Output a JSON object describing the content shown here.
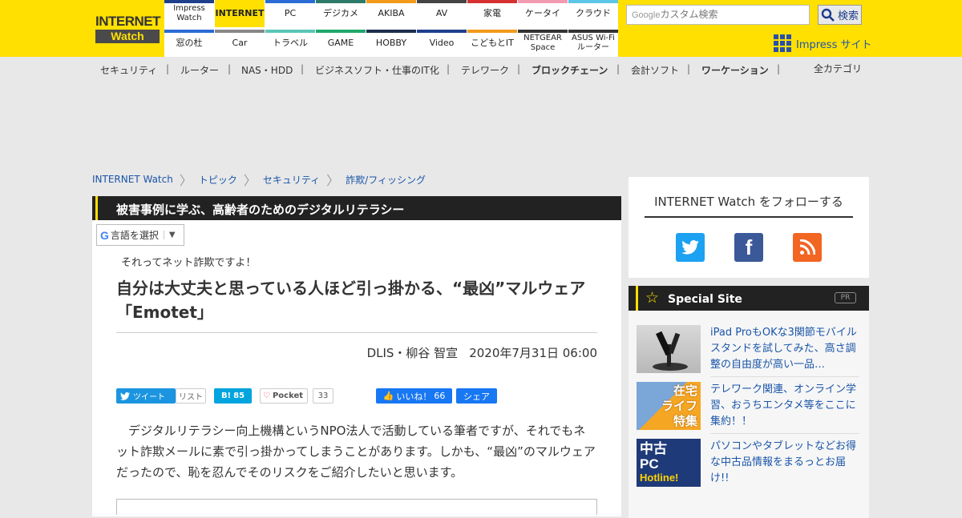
{
  "site": {
    "logo_line1": "INTERNET",
    "logo_line2": "Watch"
  },
  "nav": {
    "top": [
      {
        "label": "Impress Watch",
        "color": "#1d3f8c"
      },
      {
        "label": "INTERNET",
        "color": "#ffe000",
        "active": true
      },
      {
        "label": "PC",
        "color": "#2a6bd6"
      },
      {
        "label": "デジカメ",
        "color": "#2d7a6a"
      },
      {
        "label": "AKIBA",
        "color": "#f29a1a"
      },
      {
        "label": "AV",
        "color": "#444444"
      },
      {
        "label": "家電",
        "color": "#d63030"
      },
      {
        "label": "ケータイ",
        "color": "#f29ab0"
      },
      {
        "label": "クラウド",
        "color": "#5bc6e6"
      }
    ],
    "bottom": [
      {
        "label": "窓の杜",
        "color": "#2a6bd6"
      },
      {
        "label": "Car",
        "color": "#888888"
      },
      {
        "label": "トラベル",
        "color": "#5bc6b6"
      },
      {
        "label": "GAME",
        "color": "#1ea86a"
      },
      {
        "label": "HOBBY",
        "color": "#1e2e4e"
      },
      {
        "label": "Video",
        "color": "#1d3f8c"
      },
      {
        "label": "こどもとIT",
        "color": "#f29a1a"
      },
      {
        "label": "NETGEAR Space",
        "color": "#333333"
      },
      {
        "label": "ASUS Wi-Fiルーター",
        "color": "#333333"
      }
    ]
  },
  "search": {
    "placeholder": "カスタム検索",
    "google": "Google",
    "button": "検索"
  },
  "impress_sites": "Impress サイト",
  "subnav": {
    "items": [
      {
        "label": "セキュリティ",
        "bold": false
      },
      {
        "label": "ルーター",
        "bold": false
      },
      {
        "label": "NAS・HDD",
        "bold": false
      },
      {
        "label": "ビジネスソフト・仕事のIT化",
        "bold": false
      },
      {
        "label": "テレワーク",
        "bold": false
      },
      {
        "label": "ブロックチェーン",
        "bold": true
      },
      {
        "label": "会計ソフト",
        "bold": false
      },
      {
        "label": "ワーケーション",
        "bold": true
      }
    ],
    "all_categories": "全カテゴリ"
  },
  "breadcrumb": [
    "INTERNET Watch",
    "トピック",
    "セキュリティ",
    "詐欺/フィッシング"
  ],
  "article": {
    "series": "被害事例に学ぶ、高齢者のためのデジタルリテラシー",
    "language_select": "言語を選択",
    "kicker": "それってネット詐欺ですよ！",
    "headline": "自分は大丈夫と思っている人ほど引っ掛かる、“最凶”マルウェア「Emotet」",
    "author": "DLIS・柳谷 智宣",
    "date": "2020年7月31日 06:00",
    "body": "デジタルリテラシー向上機構というNPO法人で活動している筆者ですが、それでもネット詐欺メールに素で引っ掛かってしまうことがあります。しかも、“最凶”のマルウェアだったので、恥を忍んでそのリスクをご紹介したいと思います。"
  },
  "social": {
    "tweet": "ツイート",
    "list": "リスト",
    "hatena_count": "85",
    "pocket": "Pocket",
    "pocket_count": "33",
    "fb_like": "いいね！",
    "fb_like_count": "66",
    "fb_share": "シェア"
  },
  "follow": {
    "title": "INTERNET Watch をフォローする"
  },
  "special": {
    "title": "Special Site",
    "pr": "PR",
    "items": [
      {
        "text": "iPad ProもOKな3関節モバイルスタンドを試してみた、高さ調整の自由度が高い一品…"
      },
      {
        "text": "テレワーク関連、オンライン学習、おうちエンタメ等をここに集約！！",
        "thumb_lines": [
          "在宅",
          "ライフ",
          "特集"
        ]
      },
      {
        "text": "パソコンやタブレットなどお得な中古品情報をまるっとお届け!!",
        "thumb_lines": [
          "中古",
          "PC",
          "Hotline!"
        ]
      }
    ]
  }
}
